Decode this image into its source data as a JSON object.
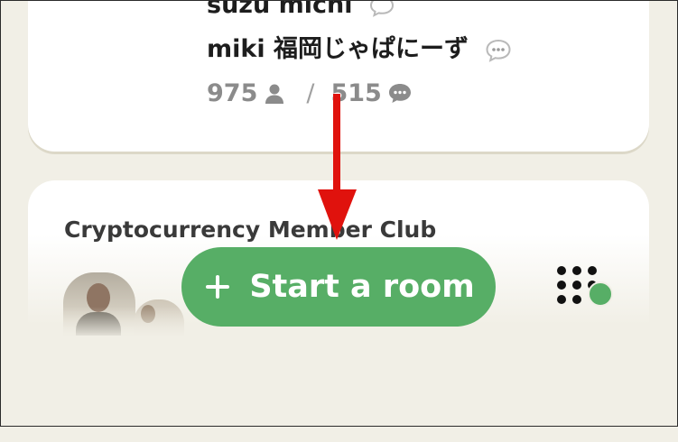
{
  "room_card": {
    "speaker_partial": "suzu michi",
    "speaker_name": "miki 福岡じゃぱにーず",
    "listeners_count": "975",
    "separator": "/",
    "speakers_count": "515",
    "icons": [
      "chat-bubble-icon",
      "person-icon",
      "chat-icon"
    ]
  },
  "club_card": {
    "title": "Cryptocurrency Member Club"
  },
  "actions": {
    "start_room_icon": "+",
    "start_room_label": "Start a room",
    "grid_icon": "dots-grid-icon"
  },
  "annotation": {
    "arrow_color": "#e0120d"
  },
  "colors": {
    "background": "#f1efe6",
    "card": "#ffffff",
    "accent_green": "#57ae66",
    "muted_text": "#8b8b8b"
  }
}
